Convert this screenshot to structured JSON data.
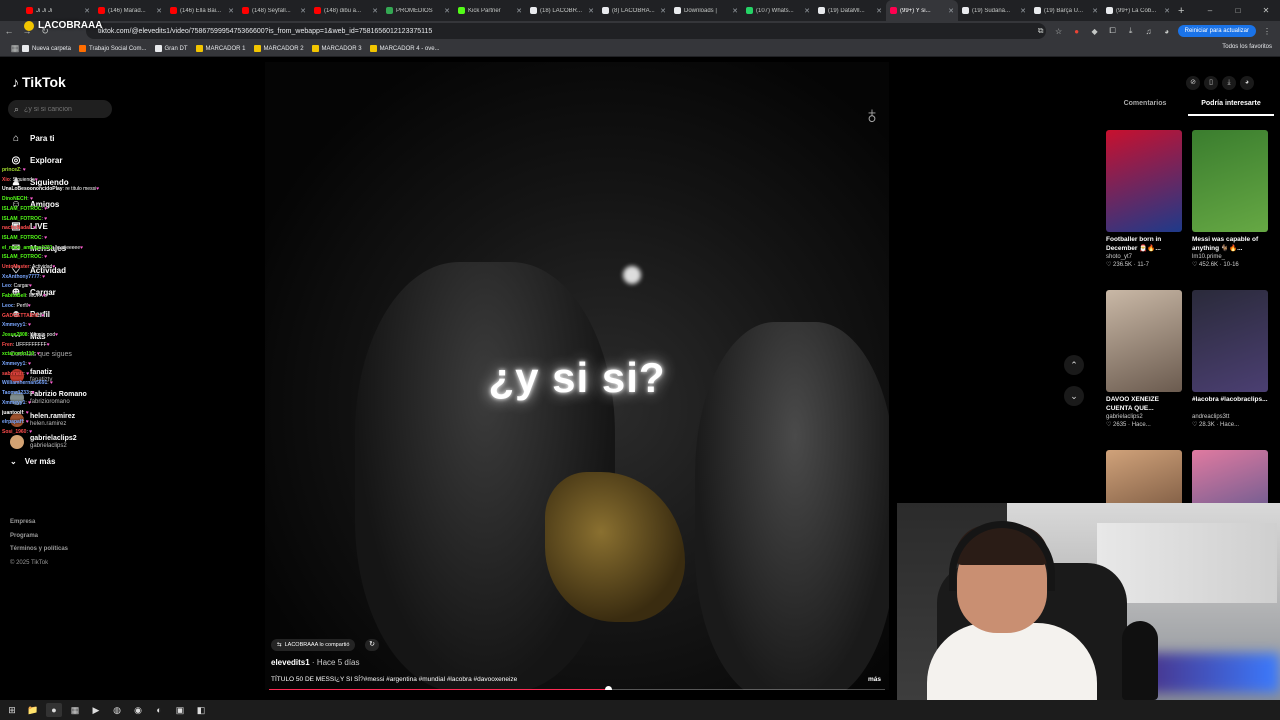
{
  "tabs": [
    {
      "title": "Ji Ji Ji",
      "color": "#ff0000"
    },
    {
      "title": "(146) Marad...",
      "color": "#ff0000"
    },
    {
      "title": "(146) Ella Bai...",
      "color": "#ff0000"
    },
    {
      "title": "(148) Seyfall...",
      "color": "#ff0000"
    },
    {
      "title": "(148) dibu a...",
      "color": "#ff0000"
    },
    {
      "title": "PROMEDIOS",
      "color": "#34a853"
    },
    {
      "title": "Kick Partner",
      "color": "#53fc18"
    },
    {
      "title": "(18) LACOBR...",
      "color": "#e8eaed"
    },
    {
      "title": "(8) LACOBRA...",
      "color": "#e8eaed"
    },
    {
      "title": "Downloads |",
      "color": "#e8eaed"
    },
    {
      "title": "(107) Whats...",
      "color": "#25d366"
    },
    {
      "title": "(19) DataMI...",
      "color": "#e8eaed"
    },
    {
      "title": "(99+) Y si...",
      "color": "#ff0050",
      "active": true
    },
    {
      "title": "(19) Sudaná...",
      "color": "#e8eaed"
    },
    {
      "title": "(19) Barça U...",
      "color": "#e8eaed"
    },
    {
      "title": "(99+) La Cob...",
      "color": "#e8eaed"
    }
  ],
  "new_tab": "+",
  "window_controls": {
    "minimize": "–",
    "maximize": "□",
    "close": "✕"
  },
  "toolbar": {
    "back": "←",
    "forward": "→",
    "reload": "↻",
    "url": "tiktok.com/@elevedits1/video/7586759995475366600?is_from_webapp=1&web_id=7581656012123375115",
    "update_button": "Reiniciar para actualizar"
  },
  "overlay_brand": "LACOBRAAA",
  "bookmarks": [
    {
      "label": "Nueva carpeta",
      "color": "#e8eaed"
    },
    {
      "label": "Trabajo Social Com...",
      "color": "#ff6d00"
    },
    {
      "label": "Gran DT",
      "color": "#e8eaed"
    },
    {
      "label": "MARCADOR 1",
      "color": "#f2c500"
    },
    {
      "label": "MARCADOR 2",
      "color": "#f2c500"
    },
    {
      "label": "MARCADOR 3",
      "color": "#f2c500"
    },
    {
      "label": "MARCADOR 4 - ove...",
      "color": "#f2c500"
    }
  ],
  "all_bookmarks": "Todos los favoritos",
  "tiktok": {
    "logo": "TikTok",
    "search_placeholder": "¿y si si cancion",
    "nav": [
      {
        "label": "Para ti",
        "icon": "home-icon",
        "glyph": "⌂"
      },
      {
        "label": "Explorar",
        "icon": "compass-icon",
        "glyph": "◎"
      },
      {
        "label": "Siguiendo",
        "icon": "following-icon",
        "glyph": "♟"
      },
      {
        "label": "Amigos",
        "icon": "friends-icon",
        "glyph": "☺"
      },
      {
        "label": "LIVE",
        "icon": "live-icon",
        "glyph": "▣"
      },
      {
        "label": "Mensajes",
        "icon": "messages-icon",
        "glyph": "✉"
      },
      {
        "label": "Actividad",
        "icon": "activity-icon",
        "glyph": "♡"
      },
      {
        "label": "Cargar",
        "icon": "upload-icon",
        "glyph": "⊕"
      },
      {
        "label": "Perfil",
        "icon": "profile-icon",
        "glyph": "☻"
      },
      {
        "label": "Más",
        "icon": "more-icon",
        "glyph": "⋯"
      }
    ],
    "following_header": "Cuentas que sigues",
    "following": [
      {
        "name": "fanatiz",
        "handle": "fanatiztv",
        "color": "#c0392b"
      },
      {
        "name": "Fabrizio Romano",
        "handle": "fabrizioromano",
        "color": "#7f8c8d"
      },
      {
        "name": "helen.ramirez",
        "handle": "helen.ramirez",
        "color": "#a0522d"
      },
      {
        "name": "gabrielaclips2",
        "handle": "gabrielaclips2",
        "color": "#d4a373"
      }
    ],
    "see_more": "Ver más",
    "footer": [
      "Empresa",
      "Programa",
      "Términos y políticas",
      "© 2025 TikTok"
    ]
  },
  "chat": [
    {
      "user": "princeZ",
      "msg": "",
      "color": "#a6e22e"
    },
    {
      "user": "Xio",
      "msg": "Siguiendo",
      "color": "#ff4d4d"
    },
    {
      "user": "UnaLoBesoononcidoPlay",
      "msg": "re titulo messi",
      "color": "#ffffff"
    },
    {
      "user": "DinoNECH",
      "msg": "",
      "color": "#53fc18"
    },
    {
      "user": "ISLAM_FOTROC",
      "msg": "",
      "color": "#53fc18"
    },
    {
      "user": "ISLAM_FOTROC",
      "msg": "",
      "color": "#53fc18"
    },
    {
      "user": "nachoNadal",
      "msg": "",
      "color": "#ff4d4d"
    },
    {
      "user": "ISLAM_FOTROC",
      "msg": "",
      "color": "#53fc18"
    },
    {
      "user": "el_mate_amargo1221",
      "msg": "re pijeeeee",
      "color": "#53fc18"
    },
    {
      "user": "ISLAM_FOTROC",
      "msg": "",
      "color": "#53fc18"
    },
    {
      "user": "UntoMaster",
      "msg": "Actividad",
      "color": "#ff4d4d"
    },
    {
      "user": "XxAnthony7777",
      "msg": "",
      "color": "#7aa7ff"
    },
    {
      "user": "Leo",
      "msg": "Cargar",
      "color": "#7aa7ff"
    },
    {
      "user": "FabitoBeli",
      "msg": "MUFA",
      "color": "#53fc18"
    },
    {
      "user": "Leoc",
      "msg": "Perfil",
      "color": "#7aa7ff"
    },
    {
      "user": "GADGETTARIO",
      "msg": "",
      "color": "#ff4d4d"
    },
    {
      "user": "Xmmeyy1",
      "msg": "",
      "color": "#7aa7ff"
    },
    {
      "user": "Josue2808",
      "msg": "Winsin pod",
      "color": "#53fc18"
    },
    {
      "user": "Fren",
      "msg": "UFFFFFFFFF",
      "color": "#ff4d4d"
    },
    {
      "user": "xctanordo110",
      "msg": "",
      "color": "#53fc18"
    },
    {
      "user": "Xmmeyy1",
      "msg": "",
      "color": "#7aa7ff"
    },
    {
      "user": "sabrinatr",
      "msg": "",
      "color": "#ff4d4d"
    },
    {
      "user": "Williamhernan5691",
      "msg": "",
      "color": "#7aa7ff"
    },
    {
      "user": "Taoma1233",
      "msg": "",
      "color": "#7aa7ff"
    },
    {
      "user": "Xmmeyy1",
      "msg": "",
      "color": "#7aa7ff"
    },
    {
      "user": "juantoolf",
      "msg": "",
      "color": "#ffffff"
    },
    {
      "user": "elrpapaff",
      "msg": "",
      "color": "#7aa7ff"
    },
    {
      "user": "Sosi_1960",
      "msg": "",
      "color": "#ff4d4d"
    }
  ],
  "video": {
    "overlay_title": "¿y si si?",
    "shared_by": "LACOBRAAA lo compartió",
    "author": "elevedits1",
    "posted": " · Hace 5 días",
    "description": "TÍTULO 50 DE MESSI¿Y SI SÍ?#messi #argentina #mundial #lacobra #davooxeneize",
    "more": "más",
    "progress": 0.55
  },
  "right_panel": {
    "tabs": [
      {
        "label": "Comentarios",
        "active": false
      },
      {
        "label": "Podría interesarte",
        "active": true
      }
    ],
    "cards": [
      {
        "title": "Footballer born in December 🎅🔥...",
        "user": "shoto_yt7",
        "stats": "♡ 236.5K · 11-7",
        "color1": "#c8102e",
        "color2": "#1e3a8a"
      },
      {
        "title": "Messi was capable of anything 🐐🔥...",
        "user": "lm10.prime_",
        "stats": "♡ 452.6K · 10-16",
        "color1": "#3a7d2e",
        "color2": "#66a844"
      },
      {
        "title": "DAVOO XENEIZE CUENTA QUE...",
        "user": "gabrielaclips2",
        "stats": "♡ 2635 · Hace...",
        "color1": "#c9b8a6",
        "color2": "#6b5b4f"
      },
      {
        "title": "#lacobra #lacobraclips...",
        "user": "andreaclips3tt",
        "stats": "♡ 28.3K · Hace...",
        "color1": "#2a2a3a",
        "color2": "#4b3f72"
      },
      {
        "title": "",
        "user": "",
        "stats": "",
        "color1": "#d0a27a",
        "color2": "#5a3d2b"
      },
      {
        "title": "",
        "user": "",
        "stats": "",
        "color1": "#e07aa0",
        "color2": "#3b4f8a"
      }
    ]
  },
  "taskbar": [
    "⊞",
    "📁",
    "●",
    "▦",
    "▶",
    "◍",
    "◉",
    "◐",
    "▣",
    "◧"
  ]
}
